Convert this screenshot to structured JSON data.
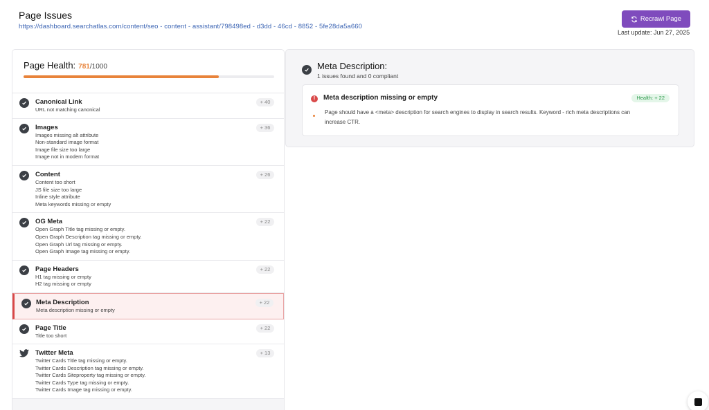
{
  "header": {
    "title": "Page Issues",
    "url": "https://dashboard.searchatlas.com/content/seo - content - assistant/798498ed - d3dd - 46cd - 8852 - 5fe28da5a660",
    "recrawl_label": "Recrawl Page",
    "last_update": "Last update: Jun 27, 2025"
  },
  "health": {
    "label": "Page Health:",
    "score": "781",
    "max": "/1000",
    "fraction": 0.78,
    "color": "#e8833a"
  },
  "issues": [
    {
      "title": "Canonical Link",
      "lines": [
        "URL not matching canonical"
      ],
      "badge": "+ 40",
      "icon": "check-circle-icon"
    },
    {
      "title": "Images",
      "lines": [
        "Images missing alt attribute",
        "Non-standard image format",
        "Image file size too large",
        "Image not in modern format"
      ],
      "badge": "+ 36",
      "icon": "check-circle-icon"
    },
    {
      "title": "Content",
      "lines": [
        "Content too short",
        "JS file size too large",
        "Inline style attribute",
        "Meta keywords missing or empty"
      ],
      "badge": "+ 26",
      "icon": "check-circle-icon"
    },
    {
      "title": "OG Meta",
      "lines": [
        "Open Graph Title tag missing or empty.",
        "Open Graph Description tag missing or empty.",
        "Open Graph Url tag missing or empty.",
        "Open Graph Image tag missing or empty."
      ],
      "badge": "+ 22",
      "icon": "check-circle-icon"
    },
    {
      "title": "Page Headers",
      "lines": [
        "H1 tag missing or empty",
        "H2 tag missing or empty"
      ],
      "badge": "+ 22",
      "icon": "check-circle-icon"
    },
    {
      "title": "Meta Description",
      "lines": [
        "Meta description missing or empty"
      ],
      "badge": "+ 22",
      "icon": "check-circle-icon",
      "active": true
    },
    {
      "title": "Page Title",
      "lines": [
        "Title too short"
      ],
      "badge": "+ 22",
      "icon": "check-circle-icon"
    },
    {
      "title": "Twitter Meta",
      "lines": [
        "Twitter Cards Title tag missing or empty.",
        "Twitter Cards Description tag missing or empty.",
        "Twitter Cards Siteproperty tag missing or empty.",
        "Twitter Cards Type tag missing or empty.",
        "Twitter Cards Image tag missing or empty."
      ],
      "badge": "+ 13",
      "icon": "twitter-bird-icon"
    }
  ],
  "detail": {
    "title": "Meta Description:",
    "summary": "1 issues found and 0 compliant",
    "card": {
      "title": "Meta description missing or empty",
      "badge": "Health: + 22",
      "description": "Page should have a <meta> description for search engines to display in search results. Keyword - rich meta descriptions can increase CTR."
    }
  },
  "colors": {
    "accent": "#7f4bbd",
    "warning": "#e8833a",
    "error": "#d94848",
    "success": "#2f9a4d"
  }
}
